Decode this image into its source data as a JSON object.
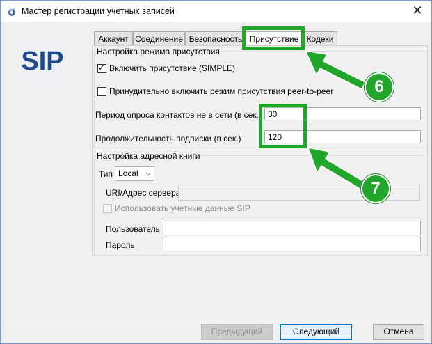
{
  "window": {
    "title": "Мастер регистрации учетных записей",
    "close_glyph": "✕",
    "icon": "wizard-app-icon"
  },
  "logo": {
    "text": "SIP",
    "color": "#1e4a8c"
  },
  "tabs": [
    {
      "label": "Аккаунт",
      "active": false
    },
    {
      "label": "Соединение",
      "active": false
    },
    {
      "label": "Безопасность",
      "active": false
    },
    {
      "label": "Присутствие",
      "active": true
    },
    {
      "label": "Кодеки",
      "active": false
    }
  ],
  "presence": {
    "group_title": "Настройка режима присутствия",
    "enable_simple": {
      "label": "Включить присутствие (SIMPLE)",
      "checked": true
    },
    "force_p2p": {
      "label": "Принудительно включить режим присутствия peer-to-peer",
      "checked": false
    },
    "poll_period": {
      "label": "Период опроса контактов не в сети (в сек.)",
      "value": "30"
    },
    "subscription_duration": {
      "label": "Продолжительность подписки (в сек.)",
      "value": "120"
    }
  },
  "address_book": {
    "group_title": "Настройка адресной книги",
    "type_label": "Тип",
    "type_value": "Local",
    "server_label": "URI/Адрес сервера",
    "server_value": "",
    "use_sip_creds": {
      "label": "Использовать учетные данные SIP",
      "checked": false,
      "disabled": true
    },
    "user_label": "Пользователь",
    "user_value": "",
    "password_label": "Пароль",
    "password_value": ""
  },
  "footer": {
    "prev_label": "Предыдущий",
    "next_label": "Следующий",
    "cancel_label": "Отмена"
  },
  "annotations": {
    "badge_6": "6",
    "badge_7": "7",
    "color": "#22a52b"
  }
}
